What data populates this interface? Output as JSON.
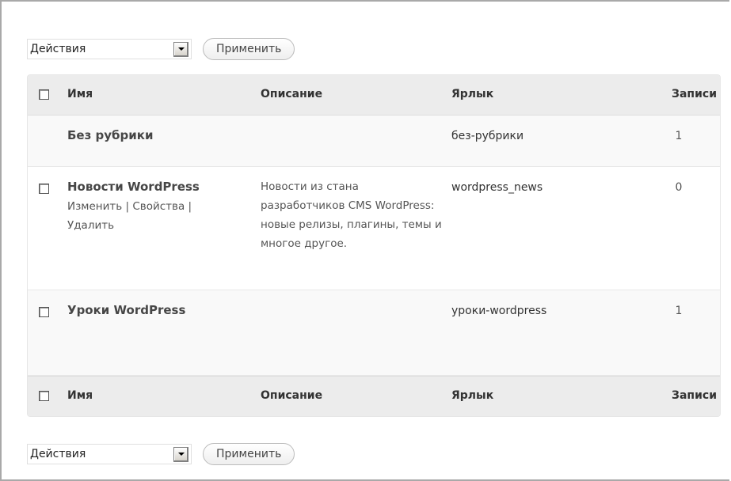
{
  "bulk_actions": {
    "select_value": "Действия",
    "apply_label": "Применить"
  },
  "columns": {
    "name": "Имя",
    "description": "Описание",
    "slug": "Ярлык",
    "posts": "Записи"
  },
  "rows": [
    {
      "name": "Без рубрики",
      "description": "",
      "slug": "без-рубрики",
      "posts": "1",
      "has_checkbox": false
    },
    {
      "name": "Новости WordPress",
      "description": "Новости из стана разработчиков CMS WordPress: новые релизы, плагины, темы и многое другое.",
      "slug": "wordpress_news",
      "posts": "0",
      "has_checkbox": true,
      "actions": {
        "edit": "Изменить",
        "separator1": " | ",
        "properties": "Свойства",
        "separator2": " |",
        "delete": "Удалить"
      }
    },
    {
      "name": "Уроки WordPress",
      "description": "",
      "slug": "уроки-wordpress",
      "posts": "1",
      "has_checkbox": true
    }
  ],
  "colors": {
    "header_bg": "#ececec",
    "border": "#a9a9a9",
    "text": "#333333"
  }
}
